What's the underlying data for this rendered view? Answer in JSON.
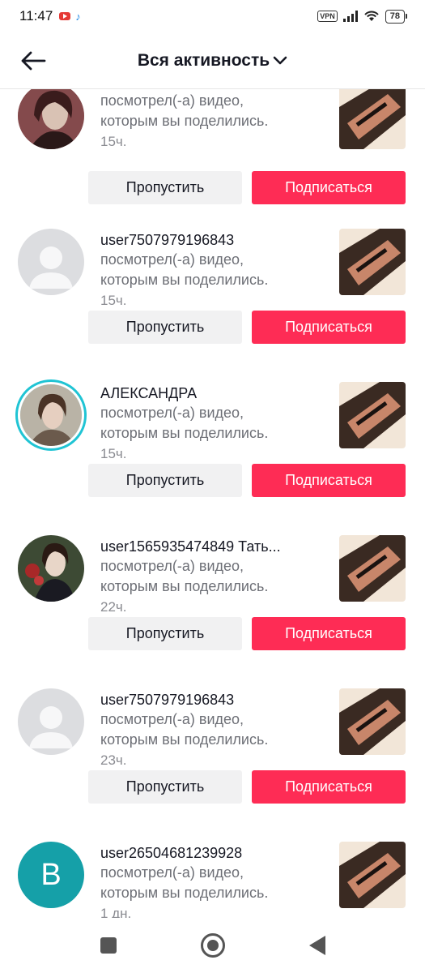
{
  "status_bar": {
    "time": "11:47",
    "vpn": "VPN",
    "battery": "78",
    "icons": [
      "youtube-icon",
      "tiktok-icon",
      "vpn-icon",
      "signal-icon",
      "wifi-icon",
      "battery-icon"
    ]
  },
  "header": {
    "title": "Вся активность",
    "back_icon": "arrow-left-icon",
    "dropdown_icon": "chevron-down-icon"
  },
  "items": [
    {
      "username": "",
      "desc_line1": "посмотрел(-а) видео,",
      "desc_line2": "которым вы поделились.",
      "time": "15ч.",
      "skip_label": "Пропустить",
      "follow_label": "Подписаться",
      "avatar_type": "photo"
    },
    {
      "username": "user7507979196843",
      "desc_line1": "посмотрел(-а) видео,",
      "desc_line2": "которым вы поделились.",
      "time": "15ч.",
      "skip_label": "Пропустить",
      "follow_label": "Подписаться",
      "avatar_type": "placeholder"
    },
    {
      "username": "АЛЕКСАНДРА",
      "desc_line1": "посмотрел(-а) видео,",
      "desc_line2": "которым вы поделились.",
      "time": "15ч.",
      "skip_label": "Пропустить",
      "follow_label": "Подписаться",
      "avatar_type": "photo-ring"
    },
    {
      "username": "user1565935474849 Тать...",
      "desc_line1": "посмотрел(-а) видео,",
      "desc_line2": "которым вы поделились.",
      "time": "22ч.",
      "skip_label": "Пропустить",
      "follow_label": "Подписаться",
      "avatar_type": "painting"
    },
    {
      "username": "user7507979196843",
      "desc_line1": "посмотрел(-а) видео,",
      "desc_line2": "которым вы поделились.",
      "time": "23ч.",
      "skip_label": "Пропустить",
      "follow_label": "Подписаться",
      "avatar_type": "placeholder"
    },
    {
      "username": "user26504681239928",
      "desc_line1": "посмотрел(-а) видео,",
      "desc_line2": "которым вы поделились.",
      "time": "1 дн.",
      "skip_label": "Пропустить",
      "follow_label": "Подписаться",
      "avatar_type": "letter",
      "avatar_letter": "B"
    }
  ],
  "navbar": {
    "icons": [
      "recents-square-icon",
      "home-circle-icon",
      "back-triangle-icon"
    ]
  },
  "colors": {
    "follow": "#fe2c55",
    "skip_bg": "#f1f1f2",
    "ring": "#20c4d4",
    "letter_avatar": "#15a0a8",
    "secondary_text": "#6d6f76"
  }
}
